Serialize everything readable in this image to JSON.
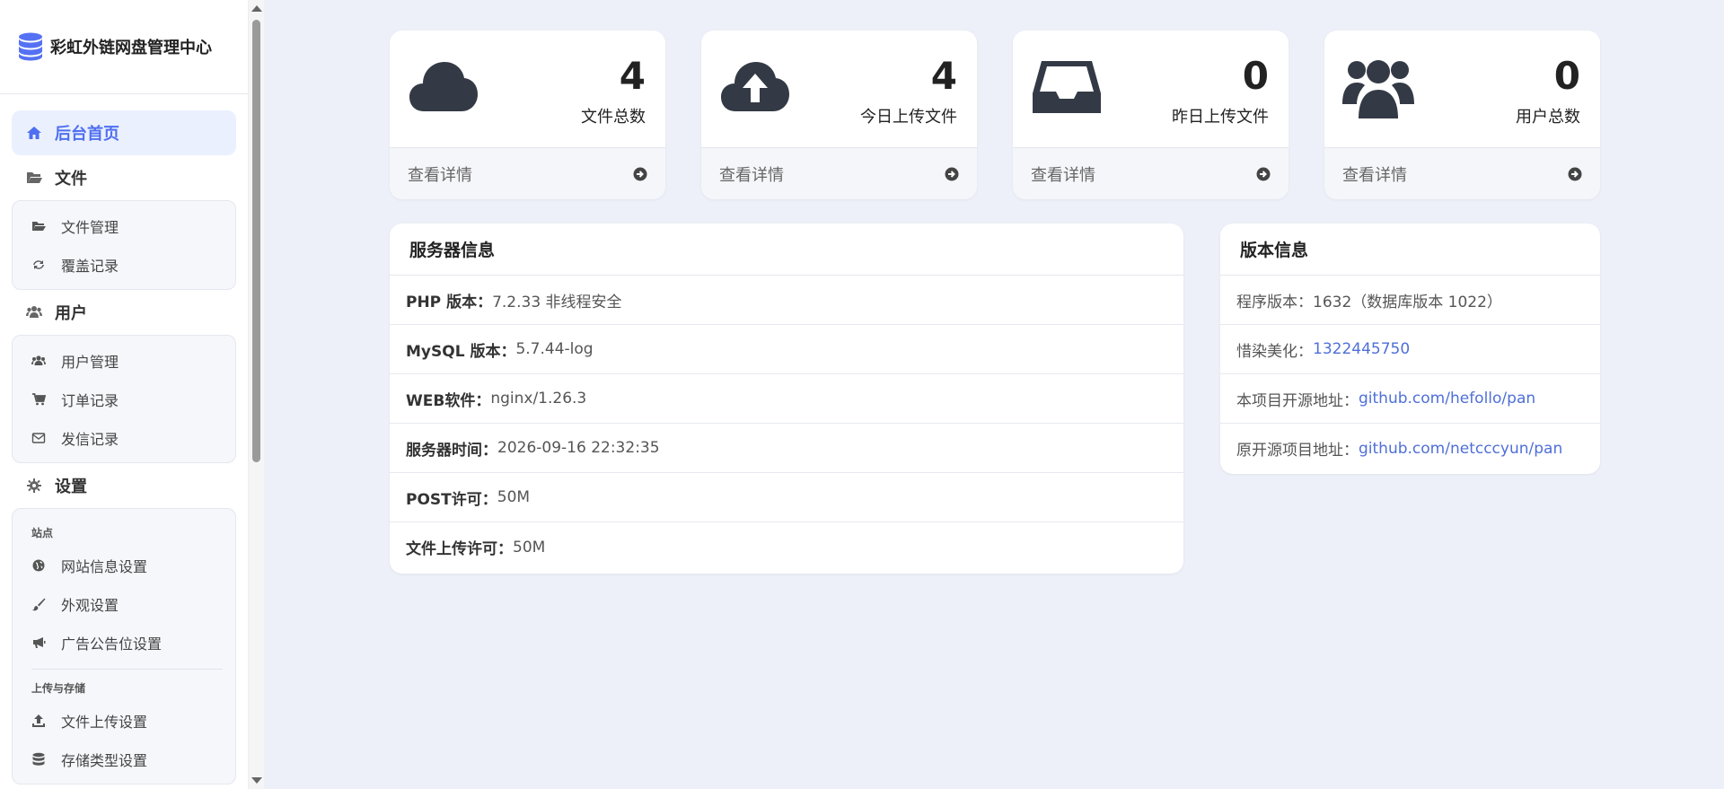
{
  "brand": {
    "title": "彩虹外链网盘管理中心",
    "icon": "database-icon",
    "color": "#5571f3"
  },
  "nav": {
    "home": "后台首页",
    "files": {
      "label": "文件",
      "items": [
        "文件管理",
        "覆盖记录"
      ]
    },
    "users": {
      "label": "用户",
      "items": [
        "用户管理",
        "订单记录",
        "发信记录"
      ]
    },
    "settings": {
      "label": "设置",
      "site_caption": "站点",
      "site_items": [
        "网站信息设置",
        "外观设置",
        "广告公告位设置"
      ],
      "upload_caption": "上传与存储",
      "upload_items": [
        "文件上传设置",
        "存储类型设置"
      ]
    }
  },
  "stats": [
    {
      "value": "4",
      "label": "文件总数",
      "link": "查看详情",
      "icon": "cloud-icon"
    },
    {
      "value": "4",
      "label": "今日上传文件",
      "link": "查看详情",
      "icon": "cloud-upload-icon"
    },
    {
      "value": "0",
      "label": "昨日上传文件",
      "link": "查看详情",
      "icon": "inbox-icon"
    },
    {
      "value": "0",
      "label": "用户总数",
      "link": "查看详情",
      "icon": "users-icon"
    }
  ],
  "server": {
    "title": "服务器信息",
    "rows": [
      {
        "k": "PHP 版本：",
        "v": "7.2.33 非线程安全"
      },
      {
        "k": "MySQL 版本：",
        "v": "5.7.44-log"
      },
      {
        "k": "WEB软件：",
        "v": "nginx/1.26.3"
      },
      {
        "k": "服务器时间：",
        "v": "2026-09-16 22:32:35"
      },
      {
        "k": "POST许可：",
        "v": "50M"
      },
      {
        "k": "文件上传许可：",
        "v": "50M"
      }
    ]
  },
  "version": {
    "title": "版本信息",
    "rows": [
      {
        "k": "程序版本：",
        "v": "1632（数据库版本 1022）"
      },
      {
        "k": "惜染美化：",
        "v": "1322445750"
      },
      {
        "k": "本项目开源地址：",
        "v": "github.com/hefollo/pan"
      },
      {
        "k": "原开源项目地址：",
        "v": "github.com/netcccyun/pan"
      }
    ]
  }
}
